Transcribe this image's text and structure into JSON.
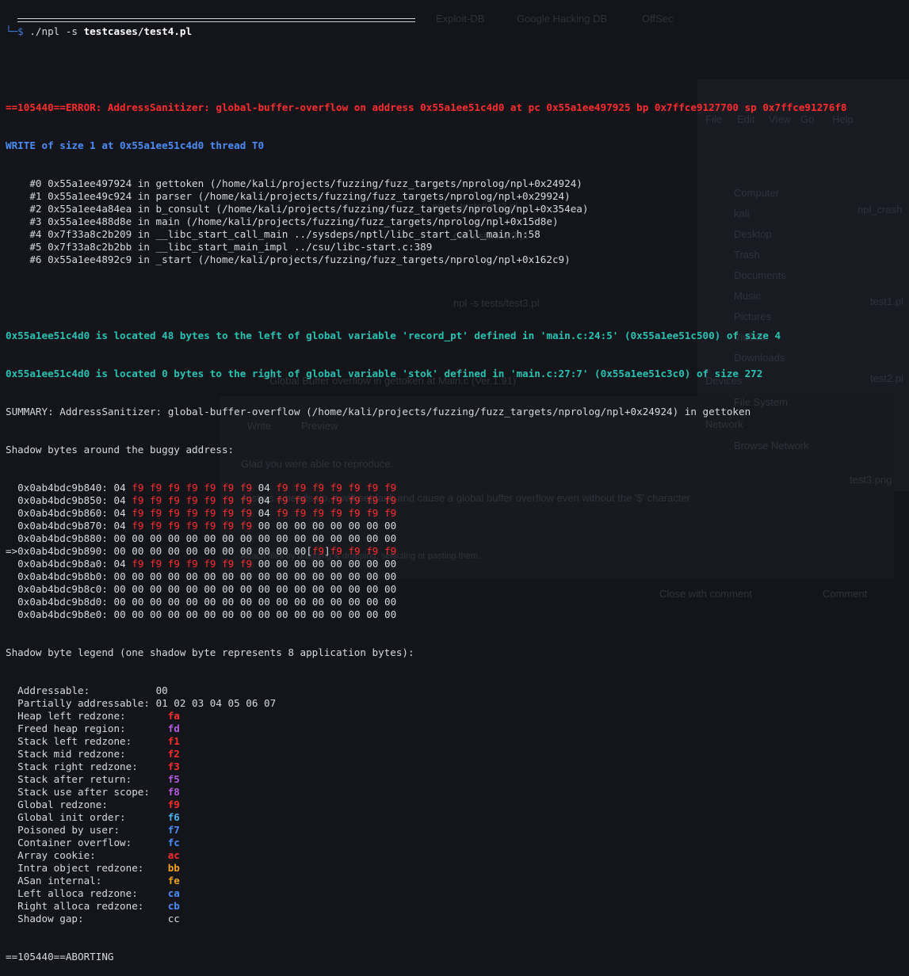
{
  "background_ghosts": {
    "tabs": [
      "Exploit-DB",
      "Google Hacking DB",
      "OffSec"
    ],
    "fm_items": [
      "Computer",
      "kali",
      "Desktop",
      "Trash",
      "Documents",
      "Music",
      "Pictures",
      "Videos",
      "Downloads"
    ],
    "fm_sections": [
      "Devices",
      "File System",
      "Network",
      "Browse Network"
    ],
    "fm_menu": [
      "File",
      "Edit",
      "View",
      "Go",
      "Help"
    ],
    "fm_files": [
      "npl_crash",
      "test1.pl",
      "test2.pl",
      "test3.pl",
      "test3.png"
    ],
    "gh_title": "Global Buffer overflow in gettoken at Main.c (Ver.1.91)",
    "gh_tabs": [
      "Write",
      "Preview"
    ],
    "gh_body1": "Glad you were able to reproduce.",
    "gh_body2": "Just as a heads up, it will segfault and cause a global buffer overflow even without the '$' character",
    "gh_attach": "Attach files by dragging & dropping, selecting or pasting them.",
    "gh_close": "Close with comment",
    "gh_comment": "Comment",
    "bg_cmds": [
      "npl -s tests/test2.pl",
      "cat tests/test3.pl",
      "npl -s tests/test3.pl"
    ]
  },
  "terminal": {
    "prompt_prefix": "└─$ ",
    "command_prog": "./npl -s ",
    "command_arg": "testcases/test4.pl",
    "error_line": "==105440==ERROR: AddressSanitizer: global-buffer-overflow on address 0x55a1ee51c4d0 at pc 0x55a1ee497925 bp 0x7ffce9127700 sp 0x7ffce91276f8",
    "write_line": "WRITE of size 1 at 0x55a1ee51c4d0 thread T0",
    "frames": [
      "    #0 0x55a1ee497924 in gettoken (/home/kali/projects/fuzzing/fuzz_targets/nprolog/npl+0x24924)",
      "    #1 0x55a1ee49c924 in parser (/home/kali/projects/fuzzing/fuzz_targets/nprolog/npl+0x29924)",
      "    #2 0x55a1ee4a84ea in b_consult (/home/kali/projects/fuzzing/fuzz_targets/nprolog/npl+0x354ea)",
      "    #3 0x55a1ee488d8e in main (/home/kali/projects/fuzzing/fuzz_targets/nprolog/npl+0x15d8e)",
      "    #4 0x7f33a8c2b209 in __libc_start_call_main ../sysdeps/nptl/libc_start_call_main.h:58",
      "    #5 0x7f33a8c2b2bb in __libc_start_main_impl ../csu/libc-start.c:389",
      "    #6 0x55a1ee4892c9 in _start (/home/kali/projects/fuzzing/fuzz_targets/nprolog/npl+0x162c9)"
    ],
    "located_1": "0x55a1ee51c4d0 is located 48 bytes to the left of global variable 'record_pt' defined in 'main.c:24:5' (0x55a1ee51c500) of size 4",
    "located_2": "0x55a1ee51c4d0 is located 0 bytes to the right of global variable 'stok' defined in 'main.c:27:7' (0x55a1ee51c3c0) of size 272",
    "summary": "SUMMARY: AddressSanitizer: global-buffer-overflow (/home/kali/projects/fuzzing/fuzz_targets/nprolog/npl+0x24924) in gettoken",
    "shadow_header": "Shadow bytes around the buggy address:",
    "shadow_rows": [
      {
        "prefix": "  ",
        "addr": "0x0ab4bdc9b840:",
        "bytes": [
          "04",
          "f9",
          "f9",
          "f9",
          "f9",
          "f9",
          "f9",
          "f9",
          "04",
          "f9",
          "f9",
          "f9",
          "f9",
          "f9",
          "f9",
          "f9"
        ]
      },
      {
        "prefix": "  ",
        "addr": "0x0ab4bdc9b850:",
        "bytes": [
          "04",
          "f9",
          "f9",
          "f9",
          "f9",
          "f9",
          "f9",
          "f9",
          "04",
          "f9",
          "f9",
          "f9",
          "f9",
          "f9",
          "f9",
          "f9"
        ]
      },
      {
        "prefix": "  ",
        "addr": "0x0ab4bdc9b860:",
        "bytes": [
          "04",
          "f9",
          "f9",
          "f9",
          "f9",
          "f9",
          "f9",
          "f9",
          "04",
          "f9",
          "f9",
          "f9",
          "f9",
          "f9",
          "f9",
          "f9"
        ]
      },
      {
        "prefix": "  ",
        "addr": "0x0ab4bdc9b870:",
        "bytes": [
          "04",
          "f9",
          "f9",
          "f9",
          "f9",
          "f9",
          "f9",
          "f9",
          "00",
          "00",
          "00",
          "00",
          "00",
          "00",
          "00",
          "00"
        ]
      },
      {
        "prefix": "  ",
        "addr": "0x0ab4bdc9b880:",
        "bytes": [
          "00",
          "00",
          "00",
          "00",
          "00",
          "00",
          "00",
          "00",
          "00",
          "00",
          "00",
          "00",
          "00",
          "00",
          "00",
          "00"
        ]
      },
      {
        "prefix": "=>",
        "addr": "0x0ab4bdc9b890:",
        "bytes": [
          "00",
          "00",
          "00",
          "00",
          "00",
          "00",
          "00",
          "00",
          "00",
          "00",
          "00",
          "[f9]",
          "f9",
          "f9",
          "f9",
          "f9"
        ]
      },
      {
        "prefix": "  ",
        "addr": "0x0ab4bdc9b8a0:",
        "bytes": [
          "04",
          "f9",
          "f9",
          "f9",
          "f9",
          "f9",
          "f9",
          "f9",
          "00",
          "00",
          "00",
          "00",
          "00",
          "00",
          "00",
          "00"
        ]
      },
      {
        "prefix": "  ",
        "addr": "0x0ab4bdc9b8b0:",
        "bytes": [
          "00",
          "00",
          "00",
          "00",
          "00",
          "00",
          "00",
          "00",
          "00",
          "00",
          "00",
          "00",
          "00",
          "00",
          "00",
          "00"
        ]
      },
      {
        "prefix": "  ",
        "addr": "0x0ab4bdc9b8c0:",
        "bytes": [
          "00",
          "00",
          "00",
          "00",
          "00",
          "00",
          "00",
          "00",
          "00",
          "00",
          "00",
          "00",
          "00",
          "00",
          "00",
          "00"
        ]
      },
      {
        "prefix": "  ",
        "addr": "0x0ab4bdc9b8d0:",
        "bytes": [
          "00",
          "00",
          "00",
          "00",
          "00",
          "00",
          "00",
          "00",
          "00",
          "00",
          "00",
          "00",
          "00",
          "00",
          "00",
          "00"
        ]
      },
      {
        "prefix": "  ",
        "addr": "0x0ab4bdc9b8e0:",
        "bytes": [
          "00",
          "00",
          "00",
          "00",
          "00",
          "00",
          "00",
          "00",
          "00",
          "00",
          "00",
          "00",
          "00",
          "00",
          "00",
          "00"
        ]
      }
    ],
    "legend_header": "Shadow byte legend (one shadow byte represents 8 application bytes):",
    "legend": [
      {
        "label": "  Addressable:           ",
        "value": "00",
        "color": "#d6d9de"
      },
      {
        "label": "  Partially addressable: ",
        "value": "01 02 03 04 05 06 07",
        "color": "#d6d9de"
      },
      {
        "label": "  Heap left redzone:       ",
        "value": "fa",
        "color": "#ff2d2d"
      },
      {
        "label": "  Freed heap region:       ",
        "value": "fd",
        "color": "#b25be0"
      },
      {
        "label": "  Stack left redzone:      ",
        "value": "f1",
        "color": "#ff2d2d"
      },
      {
        "label": "  Stack mid redzone:       ",
        "value": "f2",
        "color": "#ff2d2d"
      },
      {
        "label": "  Stack right redzone:     ",
        "value": "f3",
        "color": "#ff2d2d"
      },
      {
        "label": "  Stack after return:      ",
        "value": "f5",
        "color": "#b25be0"
      },
      {
        "label": "  Stack use after scope:   ",
        "value": "f8",
        "color": "#b25be0"
      },
      {
        "label": "  Global redzone:          ",
        "value": "f9",
        "color": "#ff2d2d"
      },
      {
        "label": "  Global init order:       ",
        "value": "f6",
        "color": "#4bb3f0"
      },
      {
        "label": "  Poisoned by user:        ",
        "value": "f7",
        "color": "#4b8df8"
      },
      {
        "label": "  Container overflow:      ",
        "value": "fc",
        "color": "#4b8df8"
      },
      {
        "label": "  Array cookie:            ",
        "value": "ac",
        "color": "#ff2d2d"
      },
      {
        "label": "  Intra object redzone:    ",
        "value": "bb",
        "color": "#f0a020"
      },
      {
        "label": "  ASan internal:           ",
        "value": "fe",
        "color": "#f0a020"
      },
      {
        "label": "  Left alloca redzone:     ",
        "value": "ca",
        "color": "#4b8df8"
      },
      {
        "label": "  Right alloca redzone:    ",
        "value": "cb",
        "color": "#4b8df8"
      },
      {
        "label": "  Shadow gap:              ",
        "value": "cc",
        "color": "#d6d9de"
      }
    ],
    "aborting": "==105440==ABORTING"
  },
  "colors": {
    "background": "#14151b",
    "error_red": "#ff2d2d",
    "write_blue": "#4b8df8",
    "located_green": "#29c2b1",
    "text": "#d6d9de"
  }
}
